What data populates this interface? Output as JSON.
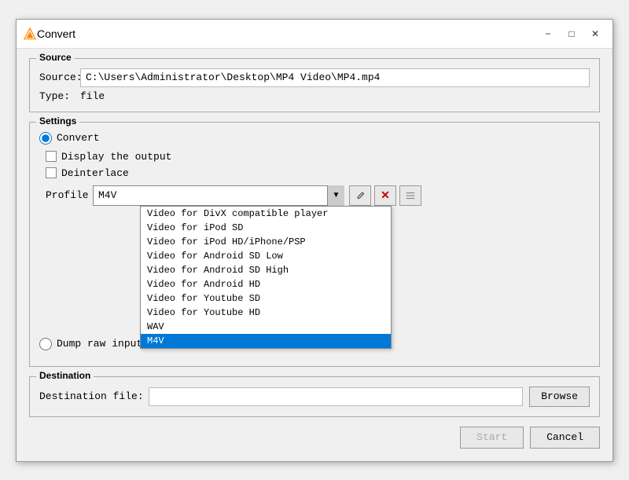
{
  "window": {
    "title": "Convert",
    "buttons": {
      "minimize": "−",
      "maximize": "□",
      "close": "✕"
    }
  },
  "source": {
    "group_label": "Source",
    "source_label": "Source:",
    "source_value": "C:\\Users\\Administrator\\Desktop\\MP4 Video\\MP4.mp4",
    "type_label": "Type:",
    "type_value": "file"
  },
  "settings": {
    "group_label": "Settings",
    "convert_radio_label": "Convert",
    "display_output_label": "Display the output",
    "deinterlace_label": "Deinterlace",
    "profile_label": "Profile",
    "profile_value": "M4V",
    "profile_options": [
      "Video for DivX compatible player",
      "Video for iPod SD",
      "Video for iPod HD/iPhone/PSP",
      "Video for Android SD Low",
      "Video for Android SD High",
      "Video for Android HD",
      "Video for Youtube SD",
      "Video for Youtube HD",
      "WAV",
      "M4V"
    ],
    "selected_profile": "M4V",
    "wrench_icon": "🔧",
    "delete_icon": "✕",
    "list_icon": "☰",
    "dump_radio_label": "Dump raw input"
  },
  "destination": {
    "group_label": "Destination",
    "dest_file_label": "Destination file:",
    "dest_file_value": "",
    "browse_label": "Browse"
  },
  "footer": {
    "start_label": "Start",
    "cancel_label": "Cancel"
  }
}
